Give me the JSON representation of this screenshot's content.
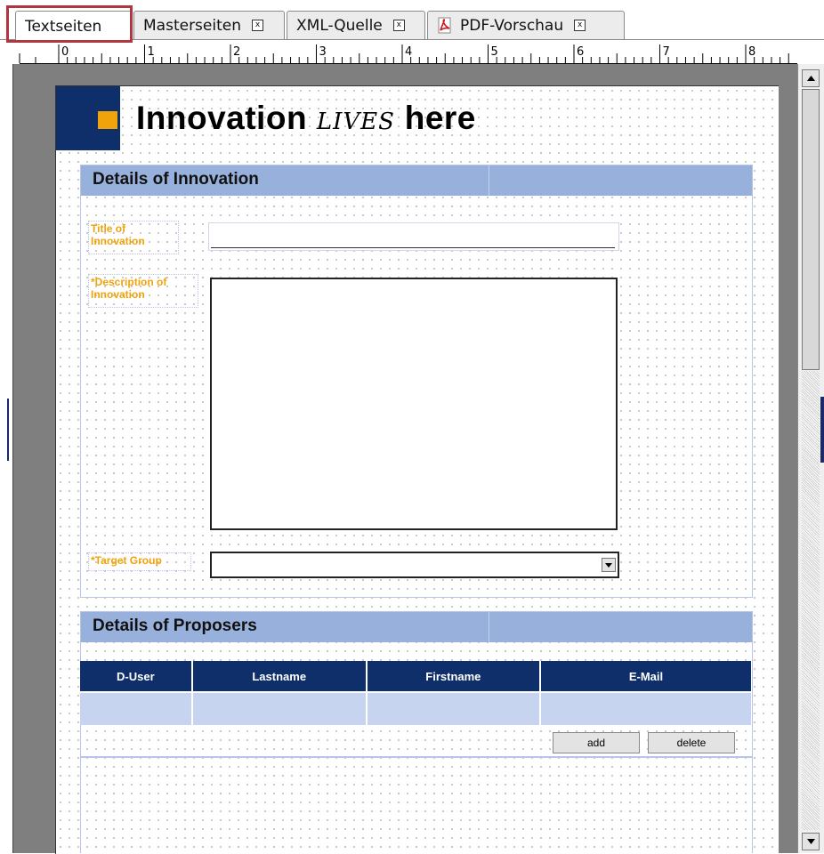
{
  "tabs": [
    {
      "label": "Textseiten",
      "active": true,
      "closable": false,
      "icon": null
    },
    {
      "label": "Masterseiten",
      "active": false,
      "closable": true,
      "icon": null
    },
    {
      "label": "XML-Quelle",
      "active": false,
      "closable": true,
      "icon": null
    },
    {
      "label": "PDF-Vorschau",
      "active": false,
      "closable": true,
      "icon": "pdf-icon"
    }
  ],
  "tab_close_glyph": "x",
  "ruler": {
    "numbers": [
      "0",
      "1",
      "2",
      "3",
      "4",
      "5",
      "6",
      "7",
      "8"
    ]
  },
  "form": {
    "title_main": "Innovation",
    "title_script": "LIVES",
    "title_end": "here",
    "section1": {
      "heading": "Details of Innovation",
      "title_label": "Title of Innovation",
      "description_label": "*Description of Innovation",
      "target_label": "*Target Group",
      "title_value": "",
      "description_value": "",
      "target_value": ""
    },
    "section2": {
      "heading": "Details of Proposers",
      "columns": [
        "D-User",
        "Lastname",
        "Firstname",
        "E-Mail"
      ],
      "rows": [
        [
          "",
          "",
          "",
          ""
        ]
      ],
      "add_label": "add",
      "delete_label": "delete"
    }
  },
  "colors": {
    "header_navy": "#0f2f6b",
    "accent_orange": "#f0a30a",
    "section_blue": "#98b1dc",
    "table_cell": "#c7d4ef",
    "highlight_frame": "#b0373f"
  }
}
